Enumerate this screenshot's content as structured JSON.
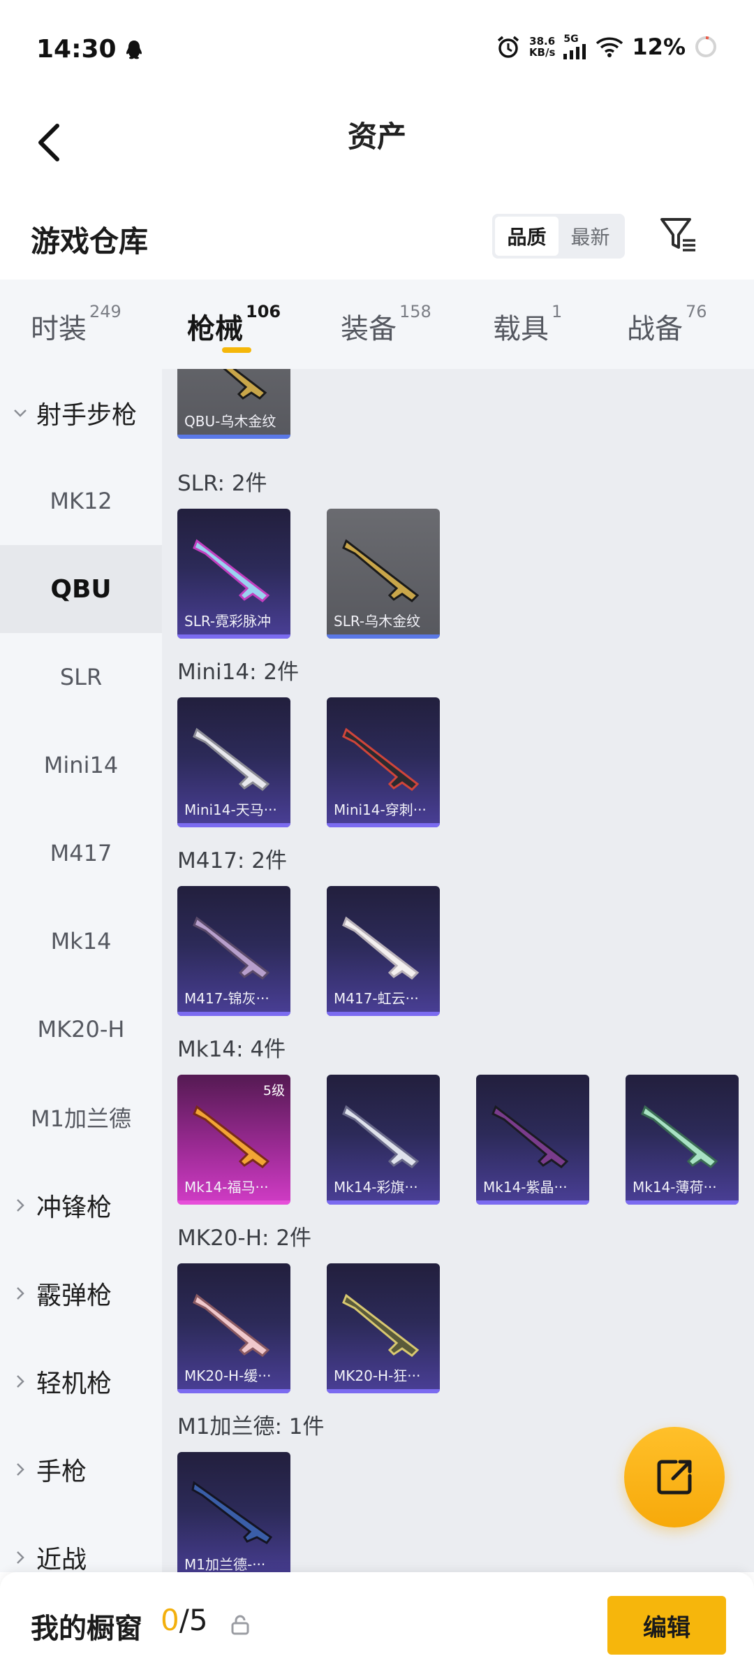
{
  "status_bar": {
    "time": "14:30",
    "net_speed_value": "38.6",
    "net_speed_unit": "KB/s",
    "signal_label": "5G",
    "battery": "12%"
  },
  "header": {
    "title": "资产"
  },
  "warehouse": {
    "title": "游戏仓库",
    "sort_options": [
      "品质",
      "最新"
    ],
    "active_sort": "品质"
  },
  "tabs": [
    {
      "label": "时装",
      "count": "249"
    },
    {
      "label": "枪械",
      "count": "106"
    },
    {
      "label": "装备",
      "count": "158"
    },
    {
      "label": "载具",
      "count": "1"
    },
    {
      "label": "战备",
      "count": "76"
    }
  ],
  "active_tab": "枪械",
  "sidebar": {
    "items": [
      {
        "label": "射手步枪",
        "type": "group-open"
      },
      {
        "label": "MK12",
        "type": "sub"
      },
      {
        "label": "QBU",
        "type": "sub-active"
      },
      {
        "label": "SLR",
        "type": "sub"
      },
      {
        "label": "Mini14",
        "type": "sub"
      },
      {
        "label": "M417",
        "type": "sub"
      },
      {
        "label": "Mk14",
        "type": "sub"
      },
      {
        "label": "MK20-H",
        "type": "sub"
      },
      {
        "label": "M1加兰德",
        "type": "sub"
      },
      {
        "label": "冲锋枪",
        "type": "group"
      },
      {
        "label": "霰弹枪",
        "type": "group"
      },
      {
        "label": "轻机枪",
        "type": "group"
      },
      {
        "label": "手枪",
        "type": "group"
      },
      {
        "label": "近战",
        "type": "group"
      }
    ]
  },
  "sections": [
    {
      "title": "",
      "items": [
        {
          "name": "QBU-乌木金纹",
          "rarity": "gray"
        }
      ]
    },
    {
      "title": "SLR: 2件",
      "items": [
        {
          "name": "SLR-霓彩脉冲",
          "rarity": "purple"
        },
        {
          "name": "SLR-乌木金纹",
          "rarity": "gray"
        }
      ]
    },
    {
      "title": "Mini14: 2件",
      "items": [
        {
          "name": "Mini14-天马···",
          "rarity": "purple"
        },
        {
          "name": "Mini14-穿刺···",
          "rarity": "purple"
        }
      ]
    },
    {
      "title": "M417: 2件",
      "items": [
        {
          "name": "M417-锦灰···",
          "rarity": "purple"
        },
        {
          "name": "M417-虹云···",
          "rarity": "purple"
        }
      ]
    },
    {
      "title": "Mk14: 4件",
      "items": [
        {
          "name": "Mk14-福马···",
          "rarity": "pink",
          "level": "5级"
        },
        {
          "name": "Mk14-彩旗···",
          "rarity": "purple"
        },
        {
          "name": "Mk14-紫晶···",
          "rarity": "purple"
        },
        {
          "name": "Mk14-薄荷···",
          "rarity": "purple"
        }
      ]
    },
    {
      "title": "MK20-H: 2件",
      "items": [
        {
          "name": "MK20-H-缓···",
          "rarity": "purple"
        },
        {
          "name": "MK20-H-狂···",
          "rarity": "purple"
        }
      ]
    },
    {
      "title": "M1加兰德: 1件",
      "items": [
        {
          "name": "M1加兰德-···",
          "rarity": "purple"
        }
      ]
    }
  ],
  "bottom_bar": {
    "label": "我的橱窗",
    "count_current": "0",
    "count_sep_total": "/5",
    "edit_label": "编辑"
  },
  "colors": {
    "accent": "#f6b60c",
    "purple_card": "#4a3f97",
    "pink_card": "#d13cc6",
    "gray_card": "#5a5b60"
  },
  "icons": [
    "back-arrow-icon",
    "filter-icon",
    "chevron-down-icon",
    "chevron-right-icon",
    "share-icon",
    "lock-icon",
    "alarm-icon",
    "wifi-icon",
    "signal-icon",
    "qq-icon",
    "battery-icon"
  ]
}
